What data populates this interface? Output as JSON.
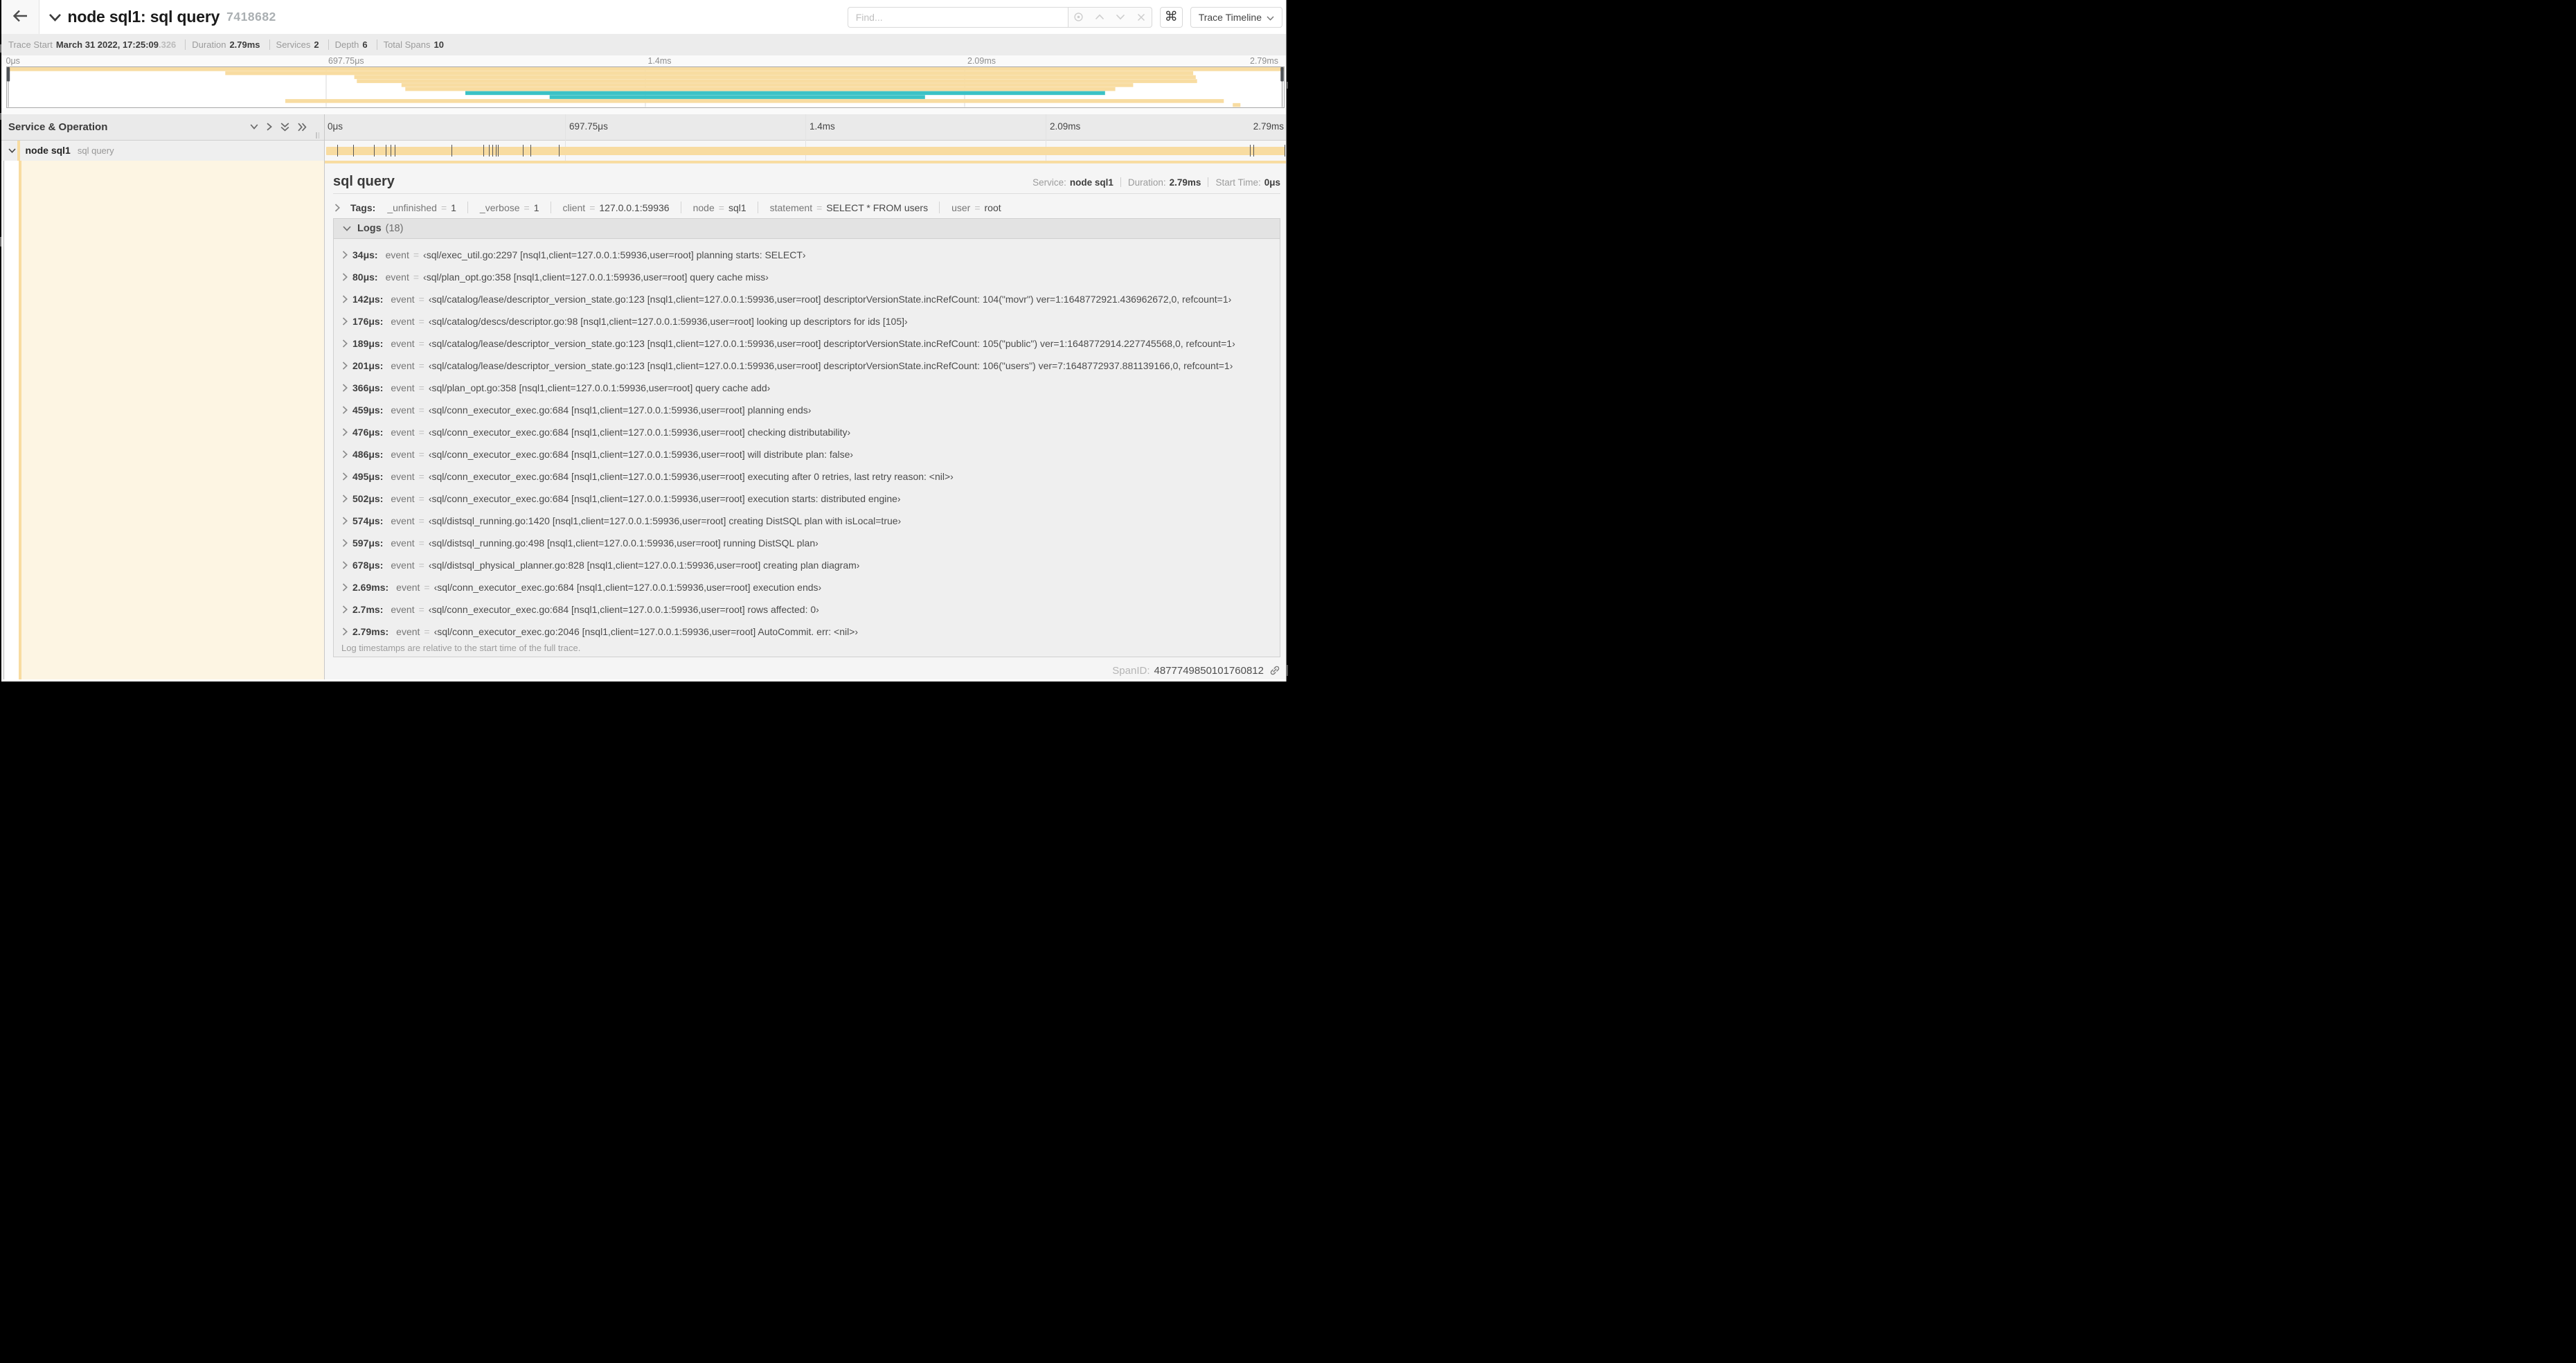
{
  "colors": {
    "tan": "#F8DCA1",
    "teal": "#3BC2C6",
    "accent_border": "#F8DCA1"
  },
  "header": {
    "back_button": "back-arrow",
    "title": "node sql1: sql query",
    "trace_id": "7418682",
    "find_placeholder": "Find...",
    "shortcut_button_label": "⌘",
    "view_select_label": "Trace Timeline"
  },
  "stats": {
    "items": [
      {
        "label": "Trace Start",
        "value": "March 31 2022, 17:25:09",
        "suffix": ".326"
      },
      {
        "label": "Duration",
        "value": "2.79ms",
        "suffix": ""
      },
      {
        "label": "Services",
        "value": "2",
        "suffix": ""
      },
      {
        "label": "Depth",
        "value": "6",
        "suffix": ""
      },
      {
        "label": "Total Spans",
        "value": "10",
        "suffix": ""
      }
    ]
  },
  "minimap": {
    "ticks": [
      "0μs",
      "697.75μs",
      "1.4ms",
      "2.09ms",
      "2.79ms"
    ],
    "spans": [
      {
        "start": 0.0,
        "end": 1.0,
        "color": "tan"
      },
      {
        "start": 0.171,
        "end": 0.929,
        "color": "tan"
      },
      {
        "start": 0.272,
        "end": 0.931,
        "color": "tan"
      },
      {
        "start": 0.274,
        "end": 0.932,
        "color": "tan"
      },
      {
        "start": 0.309,
        "end": 0.882,
        "color": "tan"
      },
      {
        "start": 0.312,
        "end": 0.868,
        "color": "tan"
      },
      {
        "start": 0.359,
        "end": 0.86,
        "color": "teal"
      },
      {
        "start": 0.425,
        "end": 0.719,
        "color": "teal"
      },
      {
        "start": 0.218,
        "end": 0.953,
        "color": "tan"
      },
      {
        "start": 0.96,
        "end": 0.966,
        "color": "tan"
      }
    ],
    "view_start": 0.0,
    "view_end": 1.0
  },
  "timeline": {
    "header_title": "Service & Operation",
    "collapse_icons": [
      "chevron-down-icon",
      "chevron-right-icon",
      "double-chevron-down-icon",
      "double-chevron-right-icon"
    ],
    "ticks": [
      "0μs",
      "697.75μs",
      "1.4ms",
      "2.09ms",
      "2.79ms"
    ],
    "row": {
      "service": "node sql1",
      "operation": "sql query",
      "bar_start": 0.0,
      "bar_end": 1.0,
      "color": "tan",
      "duration_us": 2790,
      "log_times_us": [
        34,
        80,
        142,
        176,
        189,
        201,
        366,
        459,
        476,
        486,
        495,
        502,
        574,
        597,
        678,
        2690,
        2700,
        2790
      ]
    }
  },
  "detail": {
    "operation": "sql query",
    "meta": [
      {
        "label": "Service:",
        "value": "node sql1"
      },
      {
        "label": "Duration:",
        "value": "2.79ms"
      },
      {
        "label": "Start Time:",
        "value": "0μs"
      }
    ],
    "tags_label": "Tags:",
    "tags": [
      {
        "key": "_unfinished",
        "value": "1"
      },
      {
        "key": "_verbose",
        "value": "1"
      },
      {
        "key": "client",
        "value": "127.0.0.1:59936"
      },
      {
        "key": "node",
        "value": "sql1"
      },
      {
        "key": "statement",
        "value": "SELECT * FROM users"
      },
      {
        "key": "user",
        "value": "root"
      }
    ],
    "logs_title": "Logs",
    "logs_count": "(18)",
    "logs": [
      {
        "time": "34μs:",
        "key": "event",
        "value": "‹sql/exec_util.go:2297 [nsql1,client=127.0.0.1:59936,user=root] planning starts: SELECT›"
      },
      {
        "time": "80μs:",
        "key": "event",
        "value": "‹sql/plan_opt.go:358 [nsql1,client=127.0.0.1:59936,user=root] query cache miss›"
      },
      {
        "time": "142μs:",
        "key": "event",
        "value": "‹sql/catalog/lease/descriptor_version_state.go:123 [nsql1,client=127.0.0.1:59936,user=root] descriptorVersionState.incRefCount: 104(\"movr\") ver=1:1648772921.436962672,0, refcount=1›"
      },
      {
        "time": "176μs:",
        "key": "event",
        "value": "‹sql/catalog/descs/descriptor.go:98 [nsql1,client=127.0.0.1:59936,user=root] looking up descriptors for ids [105]›"
      },
      {
        "time": "189μs:",
        "key": "event",
        "value": "‹sql/catalog/lease/descriptor_version_state.go:123 [nsql1,client=127.0.0.1:59936,user=root] descriptorVersionState.incRefCount: 105(\"public\") ver=1:1648772914.227745568,0, refcount=1›"
      },
      {
        "time": "201μs:",
        "key": "event",
        "value": "‹sql/catalog/lease/descriptor_version_state.go:123 [nsql1,client=127.0.0.1:59936,user=root] descriptorVersionState.incRefCount: 106(\"users\") ver=7:1648772937.881139166,0, refcount=1›"
      },
      {
        "time": "366μs:",
        "key": "event",
        "value": "‹sql/plan_opt.go:358 [nsql1,client=127.0.0.1:59936,user=root] query cache add›"
      },
      {
        "time": "459μs:",
        "key": "event",
        "value": "‹sql/conn_executor_exec.go:684 [nsql1,client=127.0.0.1:59936,user=root] planning ends›"
      },
      {
        "time": "476μs:",
        "key": "event",
        "value": "‹sql/conn_executor_exec.go:684 [nsql1,client=127.0.0.1:59936,user=root] checking distributability›"
      },
      {
        "time": "486μs:",
        "key": "event",
        "value": "‹sql/conn_executor_exec.go:684 [nsql1,client=127.0.0.1:59936,user=root] will distribute plan: false›"
      },
      {
        "time": "495μs:",
        "key": "event",
        "value": "‹sql/conn_executor_exec.go:684 [nsql1,client=127.0.0.1:59936,user=root] executing after 0 retries, last retry reason: <nil>›"
      },
      {
        "time": "502μs:",
        "key": "event",
        "value": "‹sql/conn_executor_exec.go:684 [nsql1,client=127.0.0.1:59936,user=root] execution starts: distributed engine›"
      },
      {
        "time": "574μs:",
        "key": "event",
        "value": "‹sql/distsql_running.go:1420 [nsql1,client=127.0.0.1:59936,user=root] creating DistSQL plan with isLocal=true›"
      },
      {
        "time": "597μs:",
        "key": "event",
        "value": "‹sql/distsql_running.go:498 [nsql1,client=127.0.0.1:59936,user=root] running DistSQL plan›"
      },
      {
        "time": "678μs:",
        "key": "event",
        "value": "‹sql/distsql_physical_planner.go:828 [nsql1,client=127.0.0.1:59936,user=root] creating plan diagram›"
      },
      {
        "time": "2.69ms:",
        "key": "event",
        "value": "‹sql/conn_executor_exec.go:684 [nsql1,client=127.0.0.1:59936,user=root] execution ends›"
      },
      {
        "time": "2.7ms:",
        "key": "event",
        "value": "‹sql/conn_executor_exec.go:684 [nsql1,client=127.0.0.1:59936,user=root] rows affected: 0›"
      },
      {
        "time": "2.79ms:",
        "key": "event",
        "value": "‹sql/conn_executor_exec.go:2046 [nsql1,client=127.0.0.1:59936,user=root] AutoCommit. err: <nil>›"
      }
    ],
    "logs_footer": "Log timestamps are relative to the start time of the full trace.",
    "spanid_label": "SpanID:",
    "spanid_value": "4877749850101760812"
  }
}
